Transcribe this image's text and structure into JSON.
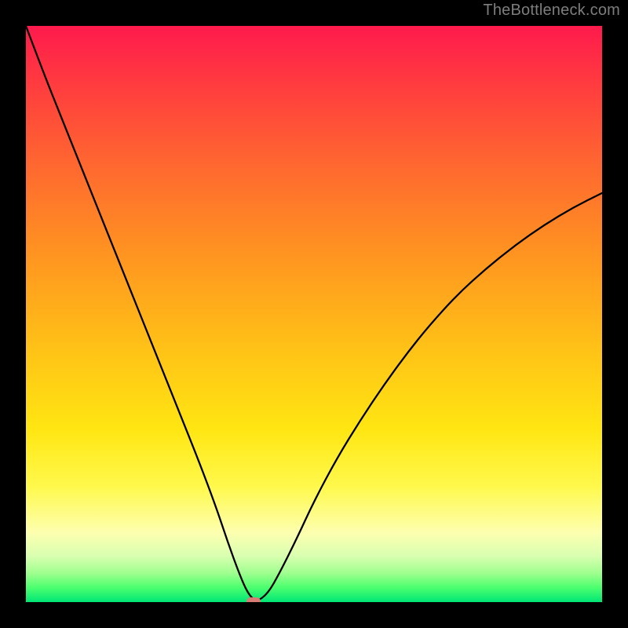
{
  "watermark": "TheBottleneck.com",
  "chart_data": {
    "type": "line",
    "title": "",
    "xlabel": "",
    "ylabel": "",
    "xlim": [
      0,
      100
    ],
    "ylim": [
      0,
      100
    ],
    "grid": false,
    "legend": false,
    "gradient_stops": [
      {
        "pct": 0,
        "color": "#ff1a4d"
      },
      {
        "pct": 10,
        "color": "#ff3b3f"
      },
      {
        "pct": 25,
        "color": "#ff6a2f"
      },
      {
        "pct": 40,
        "color": "#ff9520"
      },
      {
        "pct": 55,
        "color": "#ffbf17"
      },
      {
        "pct": 70,
        "color": "#ffe612"
      },
      {
        "pct": 80,
        "color": "#fff94d"
      },
      {
        "pct": 88,
        "color": "#fdffb0"
      },
      {
        "pct": 92,
        "color": "#d9ffb0"
      },
      {
        "pct": 95,
        "color": "#9eff8e"
      },
      {
        "pct": 97.5,
        "color": "#4bff6e"
      },
      {
        "pct": 100,
        "color": "#00e676"
      }
    ],
    "series": [
      {
        "name": "curve",
        "x": [
          0,
          3,
          6,
          9,
          12,
          15,
          18,
          21,
          24,
          27,
          30,
          33,
          35,
          37,
          38.5,
          40,
          42,
          44,
          47,
          50,
          54,
          58,
          62,
          66,
          70,
          75,
          80,
          85,
          90,
          95,
          100
        ],
        "y": [
          100,
          92,
          84.5,
          77,
          69.5,
          62,
          54.5,
          47,
          39.5,
          32,
          24.5,
          16.5,
          10.5,
          5,
          1.5,
          0,
          1.5,
          5,
          11,
          17.5,
          25,
          31.5,
          37.5,
          43,
          48,
          53.5,
          58,
          62,
          65.5,
          68.5,
          71
        ]
      }
    ],
    "optimum_marker": {
      "x": 39.5,
      "y": 0
    }
  }
}
